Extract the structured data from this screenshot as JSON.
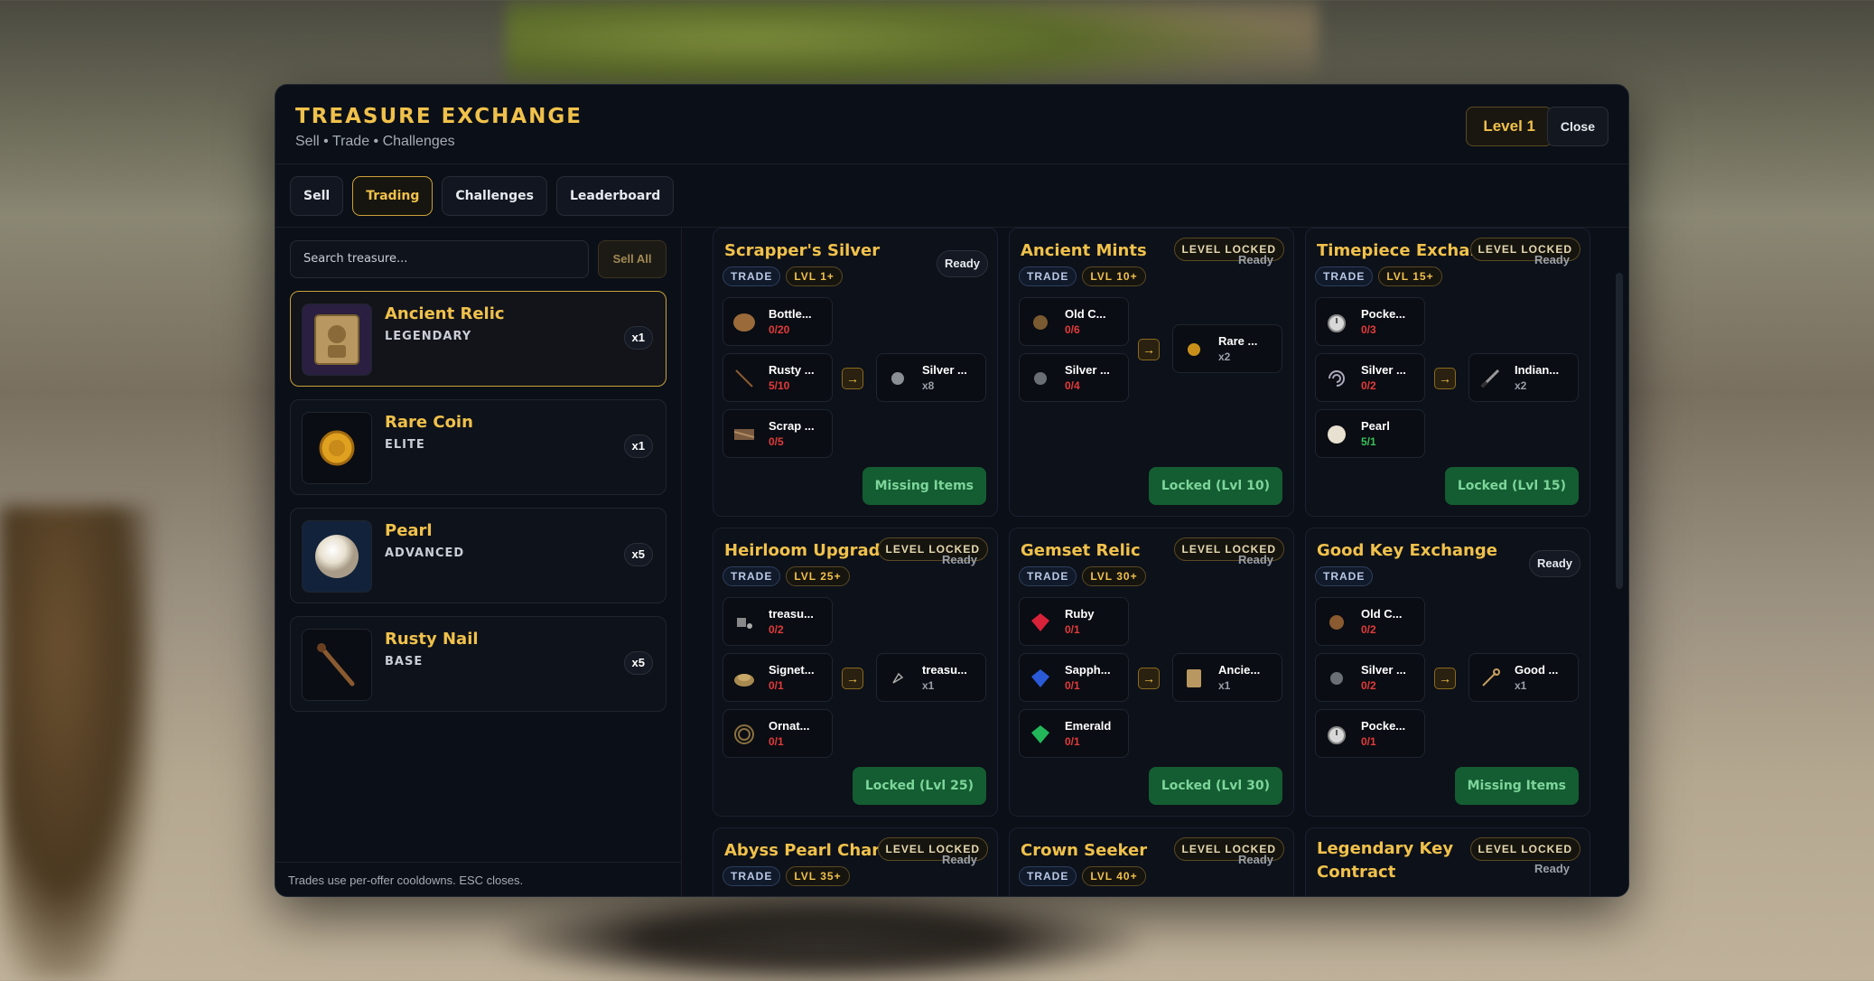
{
  "header": {
    "title": "TREASURE EXCHANGE",
    "subtitle": "Sell • Trade • Challenges",
    "level": "Level 1",
    "close": "Close"
  },
  "tabs": [
    "Sell",
    "Trading",
    "Challenges",
    "Leaderboard"
  ],
  "active_tab": "Trading",
  "search": {
    "placeholder": "Search treasure...",
    "sell_all": "Sell All"
  },
  "inventory": [
    {
      "name": "Ancient Relic",
      "rarity": "LEGENDARY",
      "qty": "x1",
      "icon": "relic-icon"
    },
    {
      "name": "Rare Coin",
      "rarity": "ELITE",
      "qty": "x1",
      "icon": "coin-icon"
    },
    {
      "name": "Pearl",
      "rarity": "ADVANCED",
      "qty": "x5",
      "icon": "pearl-icon"
    },
    {
      "name": "Rusty Nail",
      "rarity": "BASE",
      "qty": "x5",
      "icon": "nail-icon"
    }
  ],
  "footer": "Trades use per-offer cooldowns. ESC closes.",
  "offers": [
    {
      "name": "Scrapper's Silver",
      "status": "Ready",
      "locked": "",
      "trade": "TRADE",
      "lvl": "LVL 1+",
      "reqs": [
        {
          "n": "Bottle...",
          "c": "0/20"
        },
        {
          "n": "Rusty ...",
          "c": "5/10"
        },
        {
          "n": "Scrap ...",
          "c": "0/5"
        }
      ],
      "reward": {
        "n": "Silver ...",
        "c": "x8"
      },
      "action": "Missing Items"
    },
    {
      "name": "Ancient Mints",
      "status": "Ready",
      "locked": "LEVEL LOCKED",
      "trade": "TRADE",
      "lvl": "LVL 10+",
      "reqs": [
        {
          "n": "Old C...",
          "c": "0/6"
        },
        {
          "n": "Silver ...",
          "c": "0/4"
        }
      ],
      "reward": {
        "n": "Rare ...",
        "c": "x2"
      },
      "action": "Locked (Lvl 10)"
    },
    {
      "name": "Timepiece Exchange",
      "status": "Ready",
      "locked": "LEVEL LOCKED",
      "trade": "TRADE",
      "lvl": "LVL 15+",
      "reqs": [
        {
          "n": "Pocke...",
          "c": "0/3"
        },
        {
          "n": "Silver ...",
          "c": "0/2"
        },
        {
          "n": "Pearl",
          "c": "5/1"
        }
      ],
      "reward": {
        "n": "Indian...",
        "c": "x2"
      },
      "action": "Locked (Lvl 15)"
    },
    {
      "name": "Heirloom Upgrade",
      "status": "Ready",
      "locked": "LEVEL LOCKED",
      "trade": "TRADE",
      "lvl": "LVL 25+",
      "reqs": [
        {
          "n": "treasu...",
          "c": "0/2"
        },
        {
          "n": "Signet...",
          "c": "0/1"
        },
        {
          "n": "Ornat...",
          "c": "0/1"
        }
      ],
      "reward": {
        "n": "treasu...",
        "c": "x1"
      },
      "action": "Locked (Lvl 25)"
    },
    {
      "name": "Gemset Relic",
      "status": "Ready",
      "locked": "LEVEL LOCKED",
      "trade": "TRADE",
      "lvl": "LVL 30+",
      "reqs": [
        {
          "n": "Ruby",
          "c": "0/1"
        },
        {
          "n": "Sapph...",
          "c": "0/1"
        },
        {
          "n": "Emerald",
          "c": "0/1"
        }
      ],
      "reward": {
        "n": "Ancie...",
        "c": "x1"
      },
      "action": "Locked (Lvl 30)"
    },
    {
      "name": "Good Key Exchange",
      "status": "Ready",
      "locked": "",
      "trade": "TRADE",
      "lvl": "",
      "reqs": [
        {
          "n": "Old C...",
          "c": "0/2"
        },
        {
          "n": "Silver ...",
          "c": "0/2"
        },
        {
          "n": "Pocke...",
          "c": "0/1"
        }
      ],
      "reward": {
        "n": "Good ...",
        "c": "x1"
      },
      "action": "Missing Items"
    },
    {
      "name": "Abyss Pearl Charter",
      "status": "Ready",
      "locked": "LEVEL LOCKED",
      "trade": "TRADE",
      "lvl": "LVL 35+"
    },
    {
      "name": "Crown Seeker",
      "status": "Ready",
      "locked": "LEVEL LOCKED",
      "trade": "TRADE",
      "lvl": "LVL 40+"
    },
    {
      "name": "Legendary Key Contract",
      "status": "Ready",
      "locked": "LEVEL LOCKED",
      "trade": "",
      "lvl": ""
    }
  ],
  "colors": {
    "accent": "#f0c14b",
    "missing": "#e23b3b",
    "ok": "#3ac05a",
    "action_bg": "#145d32"
  }
}
